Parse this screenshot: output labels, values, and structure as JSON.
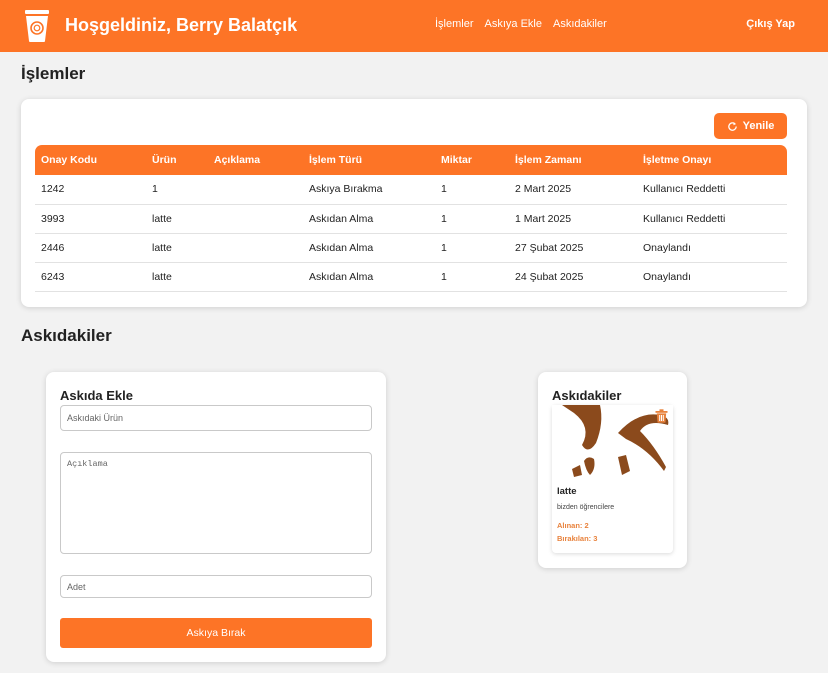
{
  "header": {
    "welcome": "Hoşgeldiniz, Berry Balatçık",
    "nav": [
      "İşlemler",
      "Askıya Ekle",
      "Askıdakiler"
    ],
    "logout": "Çıkış Yap"
  },
  "transactions": {
    "title": "İşlemler",
    "refresh_label": "Yenile",
    "columns": [
      "Onay Kodu",
      "Ürün",
      "Açıklama",
      "İşlem Türü",
      "Miktar",
      "İşlem Zamanı",
      "İşletme Onayı"
    ],
    "rows": [
      {
        "code": "1242",
        "product": "1",
        "description": "",
        "type": "Askıya Bırakma",
        "amount": "1",
        "time": "2 Mart 2025",
        "approval": "Kullanıcı Reddetti"
      },
      {
        "code": "3993",
        "product": "latte",
        "description": "",
        "type": "Askıdan Alma",
        "amount": "1",
        "time": "1 Mart 2025",
        "approval": "Kullanıcı Reddetti"
      },
      {
        "code": "2446",
        "product": "latte",
        "description": "",
        "type": "Askıdan Alma",
        "amount": "1",
        "time": "27 Şubat 2025",
        "approval": "Onaylandı"
      },
      {
        "code": "6243",
        "product": "latte",
        "description": "",
        "type": "Askıdan Alma",
        "amount": "1",
        "time": "24 Şubat 2025",
        "approval": "Onaylandı"
      }
    ]
  },
  "suspended_section": {
    "title": "Askıdakiler"
  },
  "add_form": {
    "title": "Askıda Ekle",
    "product_placeholder": "Askıdaki Ürün",
    "description_placeholder": "Açıklama",
    "quantity_placeholder": "Adet",
    "submit_label": "Askıya Bırak"
  },
  "suspended_list": {
    "title": "Askıdakiler",
    "items": [
      {
        "name": "latte",
        "description": "bizden öğrencilere",
        "taken": "Alınan: 2",
        "left": "Bırakılan: 3"
      }
    ]
  },
  "colors": {
    "accent": "#fd7426",
    "approved": "#e8823c",
    "image_brown": "#8b4a1c"
  }
}
